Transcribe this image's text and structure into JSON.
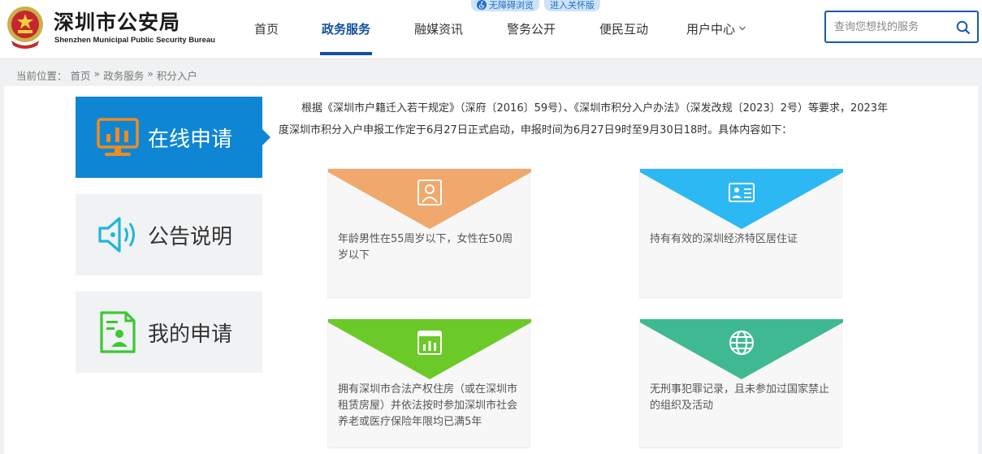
{
  "header": {
    "title": "深圳市公安局",
    "subtitle": "Shenzhen Municipal Public Security Bureau"
  },
  "accessibility": {
    "barrier_free": "无障碍浏览",
    "elder_mode": "进入关怀版"
  },
  "nav": {
    "items": [
      {
        "label": "首页"
      },
      {
        "label": "政务服务"
      },
      {
        "label": "融媒资讯"
      },
      {
        "label": "警务公开"
      },
      {
        "label": "便民互动"
      },
      {
        "label": "用户中心"
      }
    ],
    "active_index": 1
  },
  "search": {
    "placeholder": "查询您想找的服务",
    "value": ""
  },
  "breadcrumb": {
    "prefix": "当前位置：",
    "items": [
      "首页",
      "政务服务",
      "积分入户"
    ],
    "separator": "»"
  },
  "sidebar": {
    "items": [
      {
        "label": "在线申请",
        "icon": "chart-monitor-icon"
      },
      {
        "label": "公告说明",
        "icon": "speaker-icon"
      },
      {
        "label": "我的申请",
        "icon": "document-user-icon"
      }
    ],
    "active_index": 0
  },
  "intro": "根据《深圳市户籍迁入若干规定》（深府〔2016〕59号）、《深圳市积分入户办法》（深发改规〔2023〕2号）等要求，2023年度深圳市积分入户申报工作定于6月27日正式启动，申报时间为6月27日9时至9月30日18时。具体内容如下：",
  "cards": [
    {
      "text": "年龄男性在55周岁以下，女性在50周岁以下",
      "color": "#f0a86c",
      "icon": "person-portrait-icon"
    },
    {
      "text": "持有有效的深圳经济特区居住证",
      "color": "#2cb8f2",
      "icon": "id-card-icon"
    },
    {
      "text": "拥有深圳市合法产权住房（或在深圳市租赁房屋）并依法按时参加深圳市社会养老或医疗保险年限均已满5年",
      "color": "#6bc928",
      "icon": "building-chart-icon"
    },
    {
      "text": "无刑事犯罪记录，且未参加过国家禁止的组织及活动",
      "color": "#3fb992",
      "icon": "globe-icon"
    }
  ],
  "colors": {
    "primary": "#124f9c",
    "active_tab": "#0f86d3",
    "sidebar_icon_orange": "#f08c1e",
    "sidebar_icon_cyan": "#1fb6d9",
    "sidebar_icon_green": "#3cc830"
  }
}
